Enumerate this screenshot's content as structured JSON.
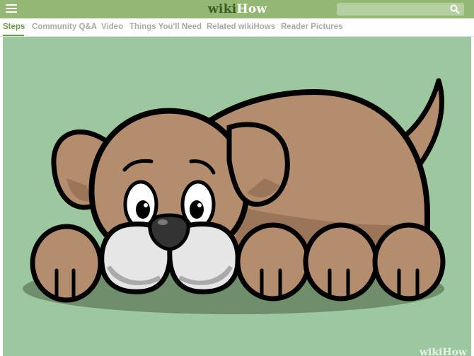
{
  "header": {
    "logo_wiki": "wiki",
    "logo_how": "How",
    "search_placeholder": ""
  },
  "tabs": [
    {
      "label": "Steps",
      "active": true
    },
    {
      "label": "Community Q&A",
      "active": false
    },
    {
      "label": "Video",
      "active": false
    },
    {
      "label": "Things You'll Need",
      "active": false
    },
    {
      "label": "Related wikiHows",
      "active": false
    },
    {
      "label": "Reader Pictures",
      "active": false
    }
  ],
  "illustration": {
    "watermark": "wikiHow"
  },
  "colors": {
    "brand_green": "#93b874",
    "active_tab": "#6a9a45",
    "background": "#9dc79e",
    "dog_fur": "#b48c6e"
  }
}
